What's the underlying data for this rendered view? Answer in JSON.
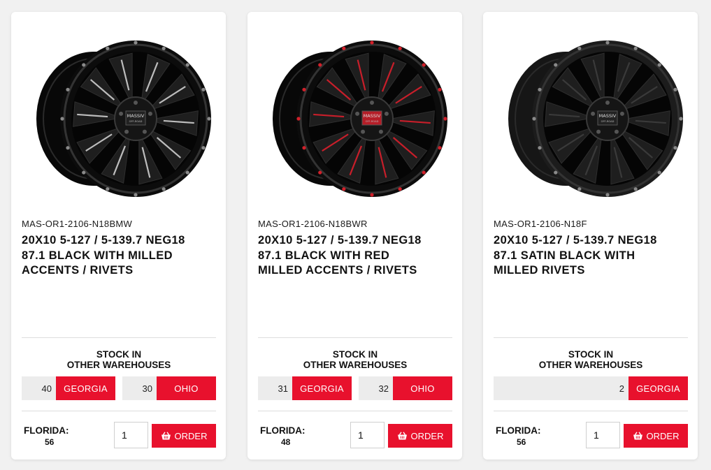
{
  "common": {
    "stock_title_line1": "STOCK IN",
    "stock_title_line2": "OTHER WAREHOUSES",
    "order_label": "ORDER",
    "florida_label": "FLORIDA:",
    "wheel_logo_line1": "MASSIV",
    "wheel_logo_line2": "OFF-ROAD"
  },
  "colors": {
    "accent": "#e8112d",
    "qty_bg": "#ececec",
    "card_bg": "#ffffff",
    "page_bg": "#f1f1f1"
  },
  "icons": {
    "order": "basket-icon"
  },
  "products": [
    {
      "sku": "MAS-OR1-2106-N18BMW",
      "title_lines": [
        "20X10 5-127 / 5-139.7 NEG18",
        "87.1 BLACK WITH MILLED",
        "ACCENTS / RIVETS"
      ],
      "warehouses": [
        {
          "qty": "40",
          "name": "GEORGIA"
        },
        {
          "qty": "30",
          "name": "OHIO"
        }
      ],
      "florida": "56",
      "order_qty": "1",
      "accent": "milled"
    },
    {
      "sku": "MAS-OR1-2106-N18BWR",
      "title_lines": [
        "20X10 5-127 / 5-139.7 NEG18",
        "87.1 BLACK WITH RED",
        "MILLED ACCENTS / RIVETS"
      ],
      "warehouses": [
        {
          "qty": "31",
          "name": "GEORGIA"
        },
        {
          "qty": "32",
          "name": "OHIO"
        }
      ],
      "florida": "48",
      "order_qty": "1",
      "accent": "red"
    },
    {
      "sku": "MAS-OR1-2106-N18F",
      "title_lines": [
        "20X10 5-127 / 5-139.7 NEG18",
        "87.1 SATIN BLACK WITH",
        "MILLED RIVETS"
      ],
      "warehouses": [
        {
          "qty": "2",
          "name": "GEORGIA"
        }
      ],
      "florida": "56",
      "order_qty": "1",
      "accent": "satin"
    }
  ]
}
